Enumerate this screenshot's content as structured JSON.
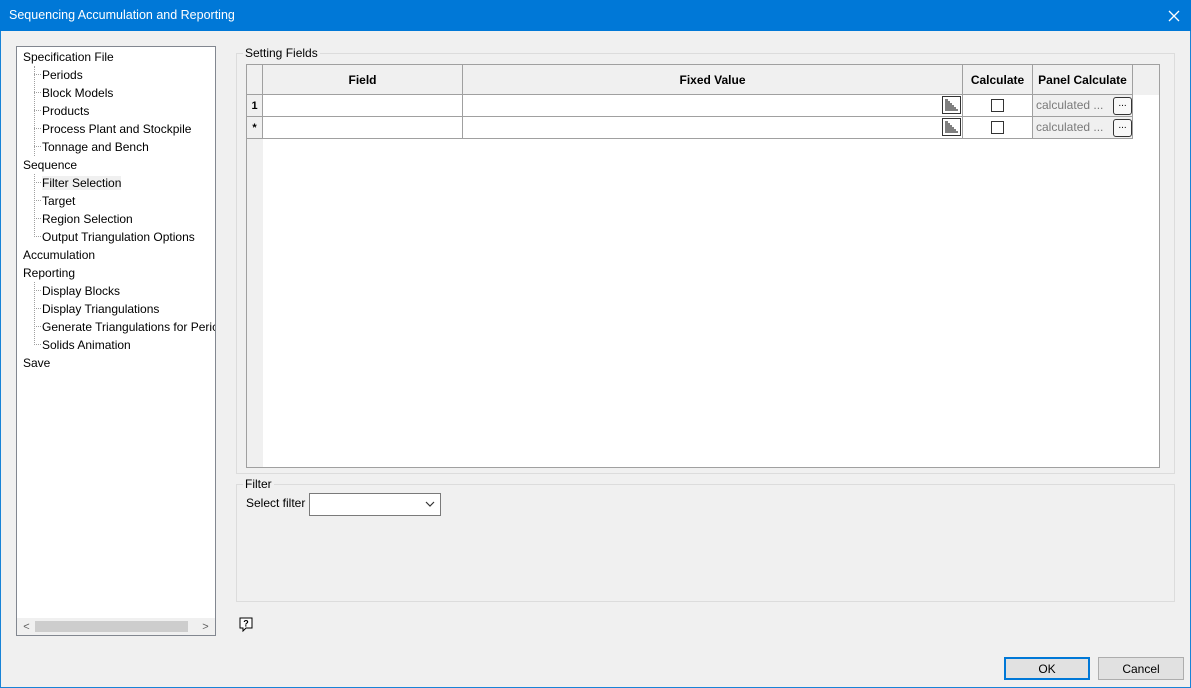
{
  "window": {
    "title": "Sequencing Accumulation and Reporting",
    "close_glyph": "✕"
  },
  "tree": {
    "items": [
      {
        "label": "Specification File",
        "level": 0
      },
      {
        "label": "Periods",
        "level": 1
      },
      {
        "label": "Block Models",
        "level": 1
      },
      {
        "label": "Products",
        "level": 1
      },
      {
        "label": "Process Plant and Stockpile",
        "level": 1
      },
      {
        "label": "Tonnage and Bench",
        "level": 1
      },
      {
        "label": "Sequence",
        "level": 0
      },
      {
        "label": "Filter Selection",
        "level": 1,
        "selected": true
      },
      {
        "label": "Target",
        "level": 1
      },
      {
        "label": "Region Selection",
        "level": 1
      },
      {
        "label": "Output Triangulation Options",
        "level": 1
      },
      {
        "label": "Accumulation",
        "level": 0
      },
      {
        "label": "Reporting",
        "level": 0
      },
      {
        "label": "Display Blocks",
        "level": 1
      },
      {
        "label": "Display Triangulations",
        "level": 1
      },
      {
        "label": "Generate Triangulations for Peric",
        "level": 1
      },
      {
        "label": "Solids Animation",
        "level": 1
      },
      {
        "label": "Save",
        "level": 0
      }
    ],
    "scroll_left": "<",
    "scroll_right": ">"
  },
  "setting_fields": {
    "label": "Setting Fields",
    "columns": {
      "field": "Field",
      "fixed_value": "Fixed Value",
      "calculate": "Calculate",
      "panel_calculate": "Panel Calculate"
    },
    "rows": [
      {
        "header": "1",
        "field": "",
        "fixed_value": "",
        "calculate": false,
        "panel_calculate": "calculated ...",
        "button": "..."
      },
      {
        "header": "*",
        "field": "",
        "fixed_value": "",
        "calculate": false,
        "panel_calculate": "calculated ...",
        "button": "..."
      }
    ]
  },
  "filter": {
    "label": "Filter",
    "select_label": "Select filter",
    "select_value": ""
  },
  "buttons": {
    "ok": "OK",
    "cancel": "Cancel"
  }
}
